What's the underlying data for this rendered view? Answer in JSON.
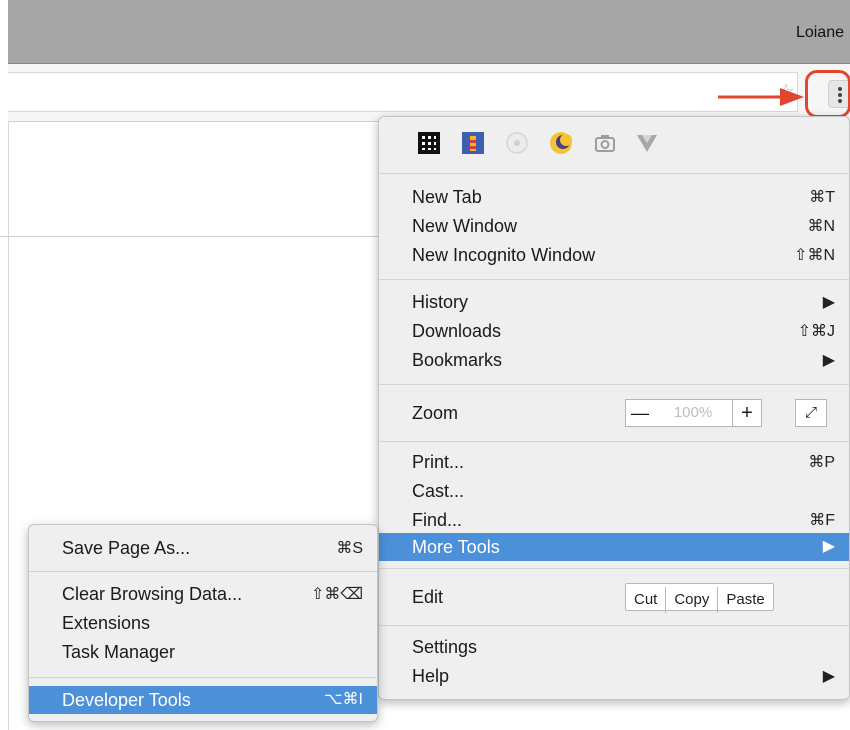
{
  "window": {
    "profile_name": "Loiane"
  },
  "main_menu": {
    "extensions": [
      "qr-grid-icon",
      "lighthouse-icon",
      "circle-extension-icon",
      "night-mode-icon",
      "camera-icon",
      "vue-devtools-icon"
    ],
    "new_tab": {
      "label": "New Tab",
      "shortcut": "⌘T"
    },
    "new_window": {
      "label": "New Window",
      "shortcut": "⌘N"
    },
    "new_incognito": {
      "label": "New Incognito Window",
      "shortcut": "⇧⌘N"
    },
    "history": {
      "label": "History",
      "shortcut": "▶"
    },
    "downloads": {
      "label": "Downloads",
      "shortcut": "⇧⌘J"
    },
    "bookmarks": {
      "label": "Bookmarks",
      "shortcut": "▶"
    },
    "zoom": {
      "label": "Zoom",
      "minus": "—",
      "value": "100%",
      "plus": "+",
      "fullscreen": "⤢"
    },
    "print": {
      "label": "Print...",
      "shortcut": "⌘P"
    },
    "cast": {
      "label": "Cast..."
    },
    "find": {
      "label": "Find...",
      "shortcut": "⌘F"
    },
    "more_tools": {
      "label": "More Tools",
      "shortcut": "▶"
    },
    "edit": {
      "label": "Edit",
      "cut": "Cut",
      "copy": "Copy",
      "paste": "Paste"
    },
    "settings": {
      "label": "Settings"
    },
    "help": {
      "label": "Help",
      "shortcut": "▶"
    }
  },
  "sub_menu": {
    "save_page": {
      "label": "Save Page As...",
      "shortcut": "⌘S"
    },
    "clear_data": {
      "label": "Clear Browsing Data...",
      "shortcut": "⇧⌘⌫"
    },
    "extensions": {
      "label": "Extensions"
    },
    "task_manager": {
      "label": "Task Manager"
    },
    "developer_tools": {
      "label": "Developer Tools",
      "shortcut": "⌥⌘I"
    }
  },
  "colors": {
    "highlight": "#4c90d9",
    "annotation": "#e2462f"
  }
}
